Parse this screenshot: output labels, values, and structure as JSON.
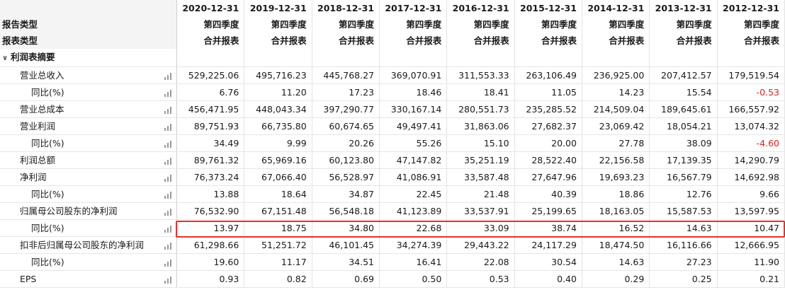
{
  "header": {
    "dates": [
      "2020-12-31",
      "2019-12-31",
      "2018-12-31",
      "2017-12-31",
      "2016-12-31",
      "2015-12-31",
      "2014-12-31",
      "2013-12-31",
      "2012-12-31"
    ],
    "report_type_label": "报告类型",
    "report_type_value": "第四季度",
    "statement_type_label": "报表类型",
    "statement_type_value": "合并报表"
  },
  "section": {
    "label": "利润表摘要",
    "expanded": true
  },
  "rows": [
    {
      "label": "营业总收入",
      "level": 1,
      "values": [
        "529,225.06",
        "495,716.23",
        "445,768.27",
        "369,070.91",
        "311,553.33",
        "263,106.49",
        "236,925.00",
        "207,412.57",
        "179,519.54"
      ]
    },
    {
      "label": "同比(%)",
      "level": 2,
      "values": [
        "6.76",
        "11.20",
        "17.23",
        "18.46",
        "18.41",
        "11.05",
        "14.23",
        "15.54",
        "-0.53"
      ]
    },
    {
      "label": "营业总成本",
      "level": 1,
      "values": [
        "456,471.95",
        "448,043.34",
        "397,290.77",
        "330,167.14",
        "280,551.73",
        "235,285.52",
        "214,509.04",
        "189,645.61",
        "166,557.92"
      ]
    },
    {
      "label": "营业利润",
      "level": 1,
      "values": [
        "89,751.93",
        "66,735.80",
        "60,674.65",
        "49,497.41",
        "31,863.06",
        "27,682.37",
        "23,069.42",
        "18,054.21",
        "13,074.32"
      ]
    },
    {
      "label": "同比(%)",
      "level": 2,
      "values": [
        "34.49",
        "9.99",
        "20.26",
        "55.26",
        "15.10",
        "20.00",
        "27.78",
        "38.09",
        "-4.60"
      ]
    },
    {
      "label": "利润总额",
      "level": 1,
      "values": [
        "89,761.32",
        "65,969.16",
        "60,123.80",
        "47,147.82",
        "35,251.19",
        "28,522.40",
        "22,156.58",
        "17,139.35",
        "14,290.79"
      ]
    },
    {
      "label": "净利润",
      "level": 1,
      "values": [
        "76,373.24",
        "67,066.40",
        "56,528.97",
        "41,086.91",
        "33,587.48",
        "27,647.96",
        "19,693.23",
        "16,567.79",
        "14,692.98"
      ]
    },
    {
      "label": "同比(%)",
      "level": 2,
      "values": [
        "13.88",
        "18.64",
        "34.87",
        "22.45",
        "21.48",
        "40.39",
        "18.86",
        "12.76",
        "9.66"
      ]
    },
    {
      "label": "归属母公司股东的净利润",
      "level": 1,
      "values": [
        "76,532.90",
        "67,151.48",
        "56,548.18",
        "41,123.89",
        "33,537.91",
        "25,199.65",
        "18,163.05",
        "15,587.53",
        "13,597.95"
      ]
    },
    {
      "label": "同比(%)",
      "level": 2,
      "highlight": true,
      "values": [
        "13.97",
        "18.75",
        "34.80",
        "22.68",
        "33.09",
        "38.74",
        "16.52",
        "14.63",
        "10.47"
      ]
    },
    {
      "label": "扣非后归属母公司股东的净利润",
      "level": 1,
      "values": [
        "61,298.66",
        "51,251.72",
        "46,101.45",
        "34,274.39",
        "29,443.22",
        "24,117.29",
        "18,474.50",
        "16,116.66",
        "12,666.95"
      ]
    },
    {
      "label": "同比(%)",
      "level": 2,
      "values": [
        "19.60",
        "11.17",
        "34.51",
        "16.41",
        "22.08",
        "30.54",
        "14.63",
        "27.23",
        "11.90"
      ]
    },
    {
      "label": "EPS",
      "level": 1,
      "values": [
        "0.93",
        "0.82",
        "0.69",
        "0.50",
        "0.53",
        "0.40",
        "0.29",
        "0.25",
        "0.21"
      ]
    }
  ],
  "colors": {
    "negative": "#e02020",
    "highlight_border": "#e8302a"
  },
  "icons": {
    "row_chart": "bar-chart-icon",
    "section_toggle": "chevron-down-icon"
  }
}
